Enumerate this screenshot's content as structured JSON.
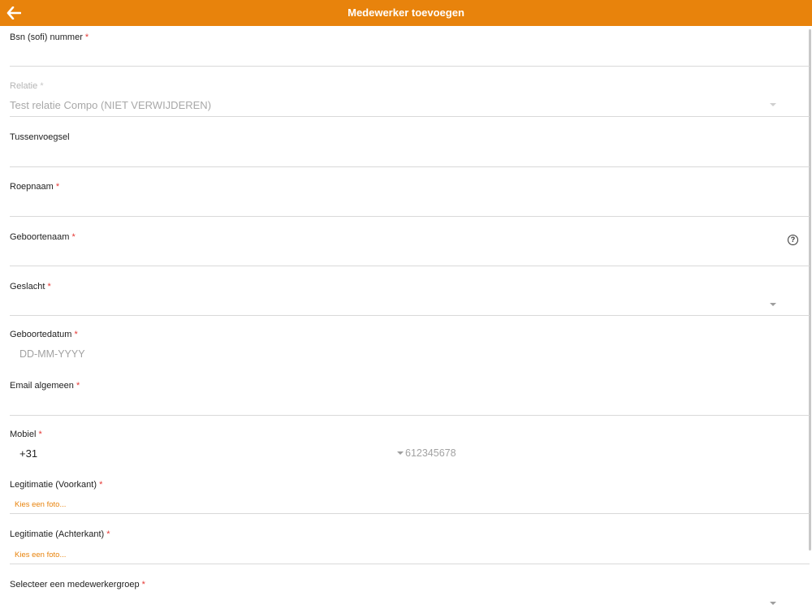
{
  "header": {
    "title": "Medewerker toevoegen",
    "background": "#e8830c",
    "back_icon": "arrow-left-icon"
  },
  "fields": {
    "bsn": {
      "label": "Bsn (sofi) nummer",
      "required": "*"
    },
    "relatie": {
      "label": "Relatie",
      "required": "*",
      "value": "Test relatie Compo (NIET VERWIJDEREN)"
    },
    "tussenvoegsel": {
      "label": "Tussenvoegsel"
    },
    "roepnaam": {
      "label": "Roepnaam",
      "required": "*"
    },
    "geboortenaam": {
      "label": "Geboortenaam",
      "required": "*",
      "help_icon": "?"
    },
    "geslacht": {
      "label": "Geslacht",
      "required": "*"
    },
    "geboortedatum": {
      "label": "Geboortedatum",
      "required": "*",
      "placeholder": "DD-MM-YYYY"
    },
    "email": {
      "label": "Email algemeen",
      "required": "*"
    },
    "mobiel": {
      "label": "Mobiel",
      "required": "*",
      "country_code": "+31",
      "placeholder": "612345678"
    },
    "leg_voorkant": {
      "label": "Legitimatie (Voorkant)",
      "required": "*",
      "link": "Kies een foto..."
    },
    "leg_achterkant": {
      "label": "Legitimatie (Achterkant)",
      "required": "*",
      "link": "Kies een foto..."
    },
    "medewerkergroep": {
      "label": "Selecteer een medewerkergroep",
      "required": "*"
    }
  },
  "colors": {
    "accent": "#e8830c",
    "required": "#e53935",
    "divider": "#d9d9d9"
  }
}
